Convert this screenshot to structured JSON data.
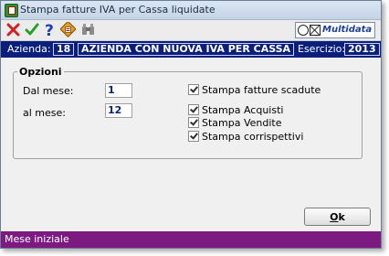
{
  "window": {
    "title": "Stampa fatture IVA per Cassa liquidate"
  },
  "toolbar": {
    "icons": [
      "close-icon",
      "check-icon",
      "help-icon",
      "report-icon",
      "binoculars-icon"
    ],
    "logo_text": "Multidata"
  },
  "header": {
    "azienda_label": "Azienda:",
    "azienda_code": "18",
    "azienda_name": "AZIENDA CON NUOVA IVA PER CASSA",
    "esercizio_label": "Esercizio:",
    "esercizio_value": "2013"
  },
  "opzioni": {
    "title": "Opzioni",
    "dal_mese_label": "Dal mese:",
    "dal_mese_value": "1",
    "al_mese_label": "al mese:",
    "al_mese_value": "12",
    "checkboxes": [
      {
        "label": "Stampa fatture scadute",
        "checked": true
      },
      {
        "label": "Stampa Acquisti",
        "checked": true
      },
      {
        "label": "Stampa Vendite",
        "checked": true
      },
      {
        "label": "Stampa corrispettivi",
        "checked": true
      }
    ]
  },
  "ok_button": {
    "mnemonic": "O",
    "rest": "k"
  },
  "status": {
    "text": "Mese iniziale"
  },
  "colors": {
    "header_bg": "#0a1e7c",
    "status_bg": "#7d1a82",
    "close_red": "#d42020",
    "check_green": "#2a9d2a",
    "help_blue": "#1a3fb5"
  }
}
